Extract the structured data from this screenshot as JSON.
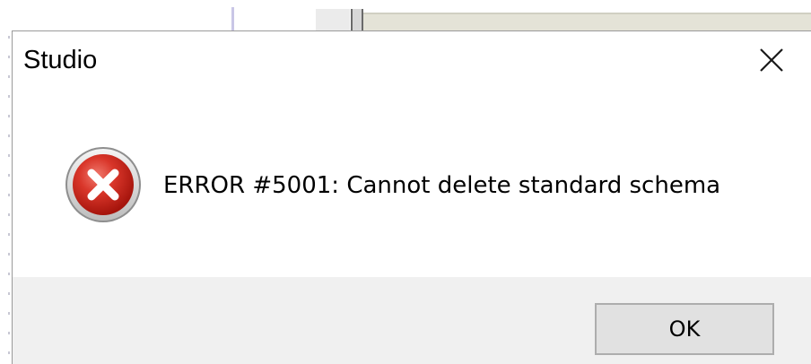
{
  "dialog": {
    "title": "Studio",
    "message": "ERROR #5001: Cannot delete standard schema",
    "ok_label": "OK",
    "icon": "error-icon",
    "close_icon": "close-icon"
  },
  "colors": {
    "error_red": "#c4241b",
    "footer_bg": "#f0f0f0",
    "button_bg": "#e1e1e1",
    "button_border": "#adadad"
  }
}
